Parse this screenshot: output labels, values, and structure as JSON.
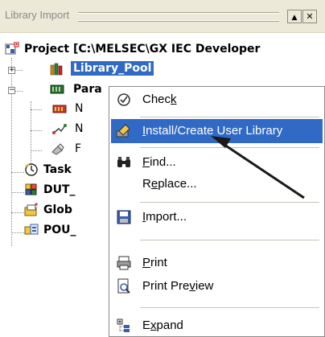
{
  "window": {
    "title": "Library Import",
    "buttons": [
      {
        "name": "dropdown-button",
        "glyph": "▲"
      },
      {
        "name": "close-button",
        "glyph": "✕"
      }
    ]
  },
  "tree": {
    "root": {
      "label": "Project [C:\\MELSEC\\GX IEC Developer",
      "icon": "project-icon"
    },
    "nodes": [
      {
        "label": "Library_Pool",
        "icon": "library-books-icon",
        "expander": "+",
        "selected": true
      },
      {
        "label": "Para",
        "icon": "parameter-icon",
        "expander": "−"
      },
      {
        "label": "N",
        "icon": "network-icon"
      },
      {
        "label": "N",
        "icon": "connection-icon"
      },
      {
        "label": "F",
        "icon": "tool-icon"
      },
      {
        "label": "Task",
        "icon": "task-clock-icon"
      },
      {
        "label": "DUT_",
        "icon": "dut-icon"
      },
      {
        "label": "Glob",
        "icon": "global-vars-icon"
      },
      {
        "label": "POU_",
        "icon": "pou-icon"
      }
    ]
  },
  "menu": {
    "items": [
      {
        "pre": "Chec",
        "u": "k",
        "post": "",
        "icon": "check-icon"
      },
      {
        "pre": "",
        "u": "I",
        "post": "nstall/Create User Library",
        "icon": "install-icon",
        "highlighted": true
      },
      {
        "pre": "",
        "u": "F",
        "post": "ind...",
        "icon": "binoculars-icon"
      },
      {
        "pre": "R",
        "u": "e",
        "post": "place...",
        "icon": ""
      },
      {
        "pre": "",
        "u": "I",
        "post": "mport...",
        "icon": "import-icon"
      },
      {
        "pre": "",
        "u": "P",
        "post": "rint",
        "icon": "printer-icon"
      },
      {
        "pre": "Print Pre",
        "u": "v",
        "post": "iew",
        "icon": "print-preview-icon"
      },
      {
        "pre": "E",
        "u": "x",
        "post": "pand",
        "icon": "expand-icon"
      }
    ]
  },
  "colors": {
    "highlight": "#316ac5",
    "selection": "#316ac5",
    "titlebar": "#ece9d8"
  }
}
